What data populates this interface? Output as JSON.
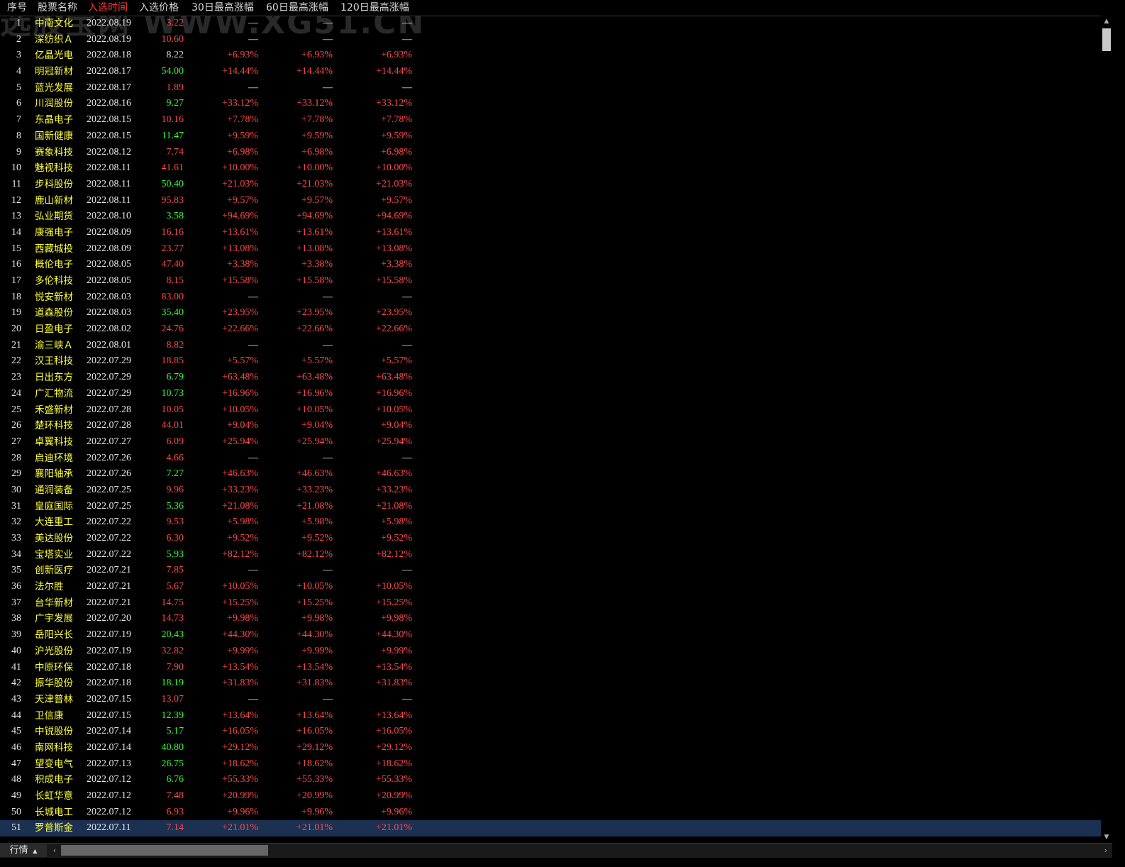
{
  "watermark": "选股宝网 WWW.XG51.CN",
  "header": {
    "no": "序号",
    "name": "股票名称",
    "time": "入选时间",
    "price": "入选价格",
    "g30": "30日最高涨幅",
    "g60": "60日最高涨幅",
    "g120": "120日最高涨幅"
  },
  "rows": [
    {
      "no": "1",
      "name": "中南文化",
      "date": "2022.08.19",
      "price": "3.22",
      "pc": "red",
      "g30": "—",
      "g60": "—",
      "g120": "—"
    },
    {
      "no": "2",
      "name": "深纺织Ａ",
      "date": "2022.08.19",
      "price": "10.60",
      "pc": "red",
      "g30": "—",
      "g60": "—",
      "g120": "—"
    },
    {
      "no": "3",
      "name": "亿晶光电",
      "date": "2022.08.18",
      "price": "8.22",
      "pc": "white",
      "g30": "+6.93%",
      "g60": "+6.93%",
      "g120": "+6.93%"
    },
    {
      "no": "4",
      "name": "明冠新材",
      "date": "2022.08.17",
      "price": "54.00",
      "pc": "green",
      "g30": "+14.44%",
      "g60": "+14.44%",
      "g120": "+14.44%"
    },
    {
      "no": "5",
      "name": "蓝光发展",
      "date": "2022.08.17",
      "price": "1.89",
      "pc": "red",
      "g30": "—",
      "g60": "—",
      "g120": "—"
    },
    {
      "no": "6",
      "name": "川润股份",
      "date": "2022.08.16",
      "price": "9.27",
      "pc": "green",
      "g30": "+33.12%",
      "g60": "+33.12%",
      "g120": "+33.12%"
    },
    {
      "no": "7",
      "name": "东晶电子",
      "date": "2022.08.15",
      "price": "10.16",
      "pc": "red",
      "g30": "+7.78%",
      "g60": "+7.78%",
      "g120": "+7.78%"
    },
    {
      "no": "8",
      "name": "国新健康",
      "date": "2022.08.15",
      "price": "11.47",
      "pc": "green",
      "g30": "+9.59%",
      "g60": "+9.59%",
      "g120": "+9.59%"
    },
    {
      "no": "9",
      "name": "赛象科技",
      "date": "2022.08.12",
      "price": "7.74",
      "pc": "red",
      "g30": "+6.98%",
      "g60": "+6.98%",
      "g120": "+6.98%"
    },
    {
      "no": "10",
      "name": "魅视科技",
      "date": "2022.08.11",
      "price": "41.61",
      "pc": "red",
      "g30": "+10.00%",
      "g60": "+10.00%",
      "g120": "+10.00%"
    },
    {
      "no": "11",
      "name": "步科股份",
      "date": "2022.08.11",
      "price": "50.40",
      "pc": "green",
      "g30": "+21.03%",
      "g60": "+21.03%",
      "g120": "+21.03%"
    },
    {
      "no": "12",
      "name": "鹿山新材",
      "date": "2022.08.11",
      "price": "95.83",
      "pc": "red",
      "g30": "+9.57%",
      "g60": "+9.57%",
      "g120": "+9.57%"
    },
    {
      "no": "13",
      "name": "弘业期货",
      "date": "2022.08.10",
      "price": "3.58",
      "pc": "green",
      "g30": "+94.69%",
      "g60": "+94.69%",
      "g120": "+94.69%"
    },
    {
      "no": "14",
      "name": "康强电子",
      "date": "2022.08.09",
      "price": "16.16",
      "pc": "red",
      "g30": "+13.61%",
      "g60": "+13.61%",
      "g120": "+13.61%"
    },
    {
      "no": "15",
      "name": "西藏城投",
      "date": "2022.08.09",
      "price": "23.77",
      "pc": "red",
      "g30": "+13.08%",
      "g60": "+13.08%",
      "g120": "+13.08%"
    },
    {
      "no": "16",
      "name": "概伦电子",
      "date": "2022.08.05",
      "price": "47.40",
      "pc": "red",
      "g30": "+3.38%",
      "g60": "+3.38%",
      "g120": "+3.38%"
    },
    {
      "no": "17",
      "name": "多伦科技",
      "date": "2022.08.05",
      "price": "8.15",
      "pc": "red",
      "g30": "+15.58%",
      "g60": "+15.58%",
      "g120": "+15.58%"
    },
    {
      "no": "18",
      "name": "悦安新材",
      "date": "2022.08.03",
      "price": "83.00",
      "pc": "red",
      "g30": "—",
      "g60": "—",
      "g120": "—"
    },
    {
      "no": "19",
      "name": "道森股份",
      "date": "2022.08.03",
      "price": "35.40",
      "pc": "green",
      "g30": "+23.95%",
      "g60": "+23.95%",
      "g120": "+23.95%"
    },
    {
      "no": "20",
      "name": "日盈电子",
      "date": "2022.08.02",
      "price": "24.76",
      "pc": "red",
      "g30": "+22.66%",
      "g60": "+22.66%",
      "g120": "+22.66%"
    },
    {
      "no": "21",
      "name": "渝三峡Ａ",
      "date": "2022.08.01",
      "price": "8.82",
      "pc": "red",
      "g30": "—",
      "g60": "—",
      "g120": "—"
    },
    {
      "no": "22",
      "name": "汉王科技",
      "date": "2022.07.29",
      "price": "18.85",
      "pc": "red",
      "g30": "+5.57%",
      "g60": "+5.57%",
      "g120": "+5.57%"
    },
    {
      "no": "23",
      "name": "日出东方",
      "date": "2022.07.29",
      "price": "6.79",
      "pc": "green",
      "g30": "+63.48%",
      "g60": "+63.48%",
      "g120": "+63.48%"
    },
    {
      "no": "24",
      "name": "广汇物流",
      "date": "2022.07.29",
      "price": "10.73",
      "pc": "green",
      "g30": "+16.96%",
      "g60": "+16.96%",
      "g120": "+16.96%"
    },
    {
      "no": "25",
      "name": "禾盛新材",
      "date": "2022.07.28",
      "price": "10.05",
      "pc": "red",
      "g30": "+10.05%",
      "g60": "+10.05%",
      "g120": "+10.05%"
    },
    {
      "no": "26",
      "name": "楚环科技",
      "date": "2022.07.28",
      "price": "44.01",
      "pc": "red",
      "g30": "+9.04%",
      "g60": "+9.04%",
      "g120": "+9.04%"
    },
    {
      "no": "27",
      "name": "卓翼科技",
      "date": "2022.07.27",
      "price": "6.09",
      "pc": "red",
      "g30": "+25.94%",
      "g60": "+25.94%",
      "g120": "+25.94%"
    },
    {
      "no": "28",
      "name": "启迪环境",
      "date": "2022.07.26",
      "price": "4.66",
      "pc": "red",
      "g30": "—",
      "g60": "—",
      "g120": "—"
    },
    {
      "no": "29",
      "name": "襄阳轴承",
      "date": "2022.07.26",
      "price": "7.27",
      "pc": "green",
      "g30": "+46.63%",
      "g60": "+46.63%",
      "g120": "+46.63%"
    },
    {
      "no": "30",
      "name": "通润装备",
      "date": "2022.07.25",
      "price": "9.96",
      "pc": "red",
      "g30": "+33.23%",
      "g60": "+33.23%",
      "g120": "+33.23%"
    },
    {
      "no": "31",
      "name": "皇庭国际",
      "date": "2022.07.25",
      "price": "5.36",
      "pc": "green",
      "g30": "+21.08%",
      "g60": "+21.08%",
      "g120": "+21.08%"
    },
    {
      "no": "32",
      "name": "大连重工",
      "date": "2022.07.22",
      "price": "9.53",
      "pc": "red",
      "g30": "+5.98%",
      "g60": "+5.98%",
      "g120": "+5.98%"
    },
    {
      "no": "33",
      "name": "美达股份",
      "date": "2022.07.22",
      "price": "6.30",
      "pc": "red",
      "g30": "+9.52%",
      "g60": "+9.52%",
      "g120": "+9.52%"
    },
    {
      "no": "34",
      "name": "宝塔实业",
      "date": "2022.07.22",
      "price": "5.93",
      "pc": "green",
      "g30": "+82.12%",
      "g60": "+82.12%",
      "g120": "+82.12%"
    },
    {
      "no": "35",
      "name": "创新医疗",
      "date": "2022.07.21",
      "price": "7.85",
      "pc": "red",
      "g30": "—",
      "g60": "—",
      "g120": "—"
    },
    {
      "no": "36",
      "name": "法尔胜",
      "date": "2022.07.21",
      "price": "5.67",
      "pc": "red",
      "g30": "+10.05%",
      "g60": "+10.05%",
      "g120": "+10.05%"
    },
    {
      "no": "37",
      "name": "台华新材",
      "date": "2022.07.21",
      "price": "14.75",
      "pc": "red",
      "g30": "+15.25%",
      "g60": "+15.25%",
      "g120": "+15.25%"
    },
    {
      "no": "38",
      "name": "广宇发展",
      "date": "2022.07.20",
      "price": "14.73",
      "pc": "red",
      "g30": "+9.98%",
      "g60": "+9.98%",
      "g120": "+9.98%"
    },
    {
      "no": "39",
      "name": "岳阳兴长",
      "date": "2022.07.19",
      "price": "20.43",
      "pc": "green",
      "g30": "+44.30%",
      "g60": "+44.30%",
      "g120": "+44.30%"
    },
    {
      "no": "40",
      "name": "沪光股份",
      "date": "2022.07.19",
      "price": "32.82",
      "pc": "red",
      "g30": "+9.99%",
      "g60": "+9.99%",
      "g120": "+9.99%"
    },
    {
      "no": "41",
      "name": "中原环保",
      "date": "2022.07.18",
      "price": "7.90",
      "pc": "red",
      "g30": "+13.54%",
      "g60": "+13.54%",
      "g120": "+13.54%"
    },
    {
      "no": "42",
      "name": "振华股份",
      "date": "2022.07.18",
      "price": "18.19",
      "pc": "green",
      "g30": "+31.83%",
      "g60": "+31.83%",
      "g120": "+31.83%"
    },
    {
      "no": "43",
      "name": "天津普林",
      "date": "2022.07.15",
      "price": "13.07",
      "pc": "red",
      "g30": "—",
      "g60": "—",
      "g120": "—"
    },
    {
      "no": "44",
      "name": "卫信康",
      "date": "2022.07.15",
      "price": "12.39",
      "pc": "green",
      "g30": "+13.64%",
      "g60": "+13.64%",
      "g120": "+13.64%"
    },
    {
      "no": "45",
      "name": "中锐股份",
      "date": "2022.07.14",
      "price": "5.17",
      "pc": "green",
      "g30": "+16.05%",
      "g60": "+16.05%",
      "g120": "+16.05%"
    },
    {
      "no": "46",
      "name": "南网科技",
      "date": "2022.07.14",
      "price": "40.80",
      "pc": "green",
      "g30": "+29.12%",
      "g60": "+29.12%",
      "g120": "+29.12%"
    },
    {
      "no": "47",
      "name": "望变电气",
      "date": "2022.07.13",
      "price": "26.75",
      "pc": "green",
      "g30": "+18.62%",
      "g60": "+18.62%",
      "g120": "+18.62%"
    },
    {
      "no": "48",
      "name": "积成电子",
      "date": "2022.07.12",
      "price": "6.76",
      "pc": "green",
      "g30": "+55.33%",
      "g60": "+55.33%",
      "g120": "+55.33%"
    },
    {
      "no": "49",
      "name": "长虹华意",
      "date": "2022.07.12",
      "price": "7.48",
      "pc": "red",
      "g30": "+20.99%",
      "g60": "+20.99%",
      "g120": "+20.99%"
    },
    {
      "no": "50",
      "name": "长城电工",
      "date": "2022.07.12",
      "price": "6.93",
      "pc": "red",
      "g30": "+9.96%",
      "g60": "+9.96%",
      "g120": "+9.96%"
    },
    {
      "no": "51",
      "name": "罗普斯金",
      "date": "2022.07.11",
      "price": "7.14",
      "pc": "red",
      "g30": "+21.01%",
      "g60": "+21.01%",
      "g120": "+21.01%",
      "selected": true
    }
  ],
  "bottom": {
    "tab_label": "行情",
    "tab_arrow_icon": "caret-up-icon",
    "scroll_left_icon": "chevron-left-icon",
    "scroll_right_icon": "chevron-right-icon"
  },
  "colors": {
    "name": "#ffff33",
    "up": "#ff4a4a",
    "down": "#33ff33",
    "selected_row": "#1c3052"
  }
}
